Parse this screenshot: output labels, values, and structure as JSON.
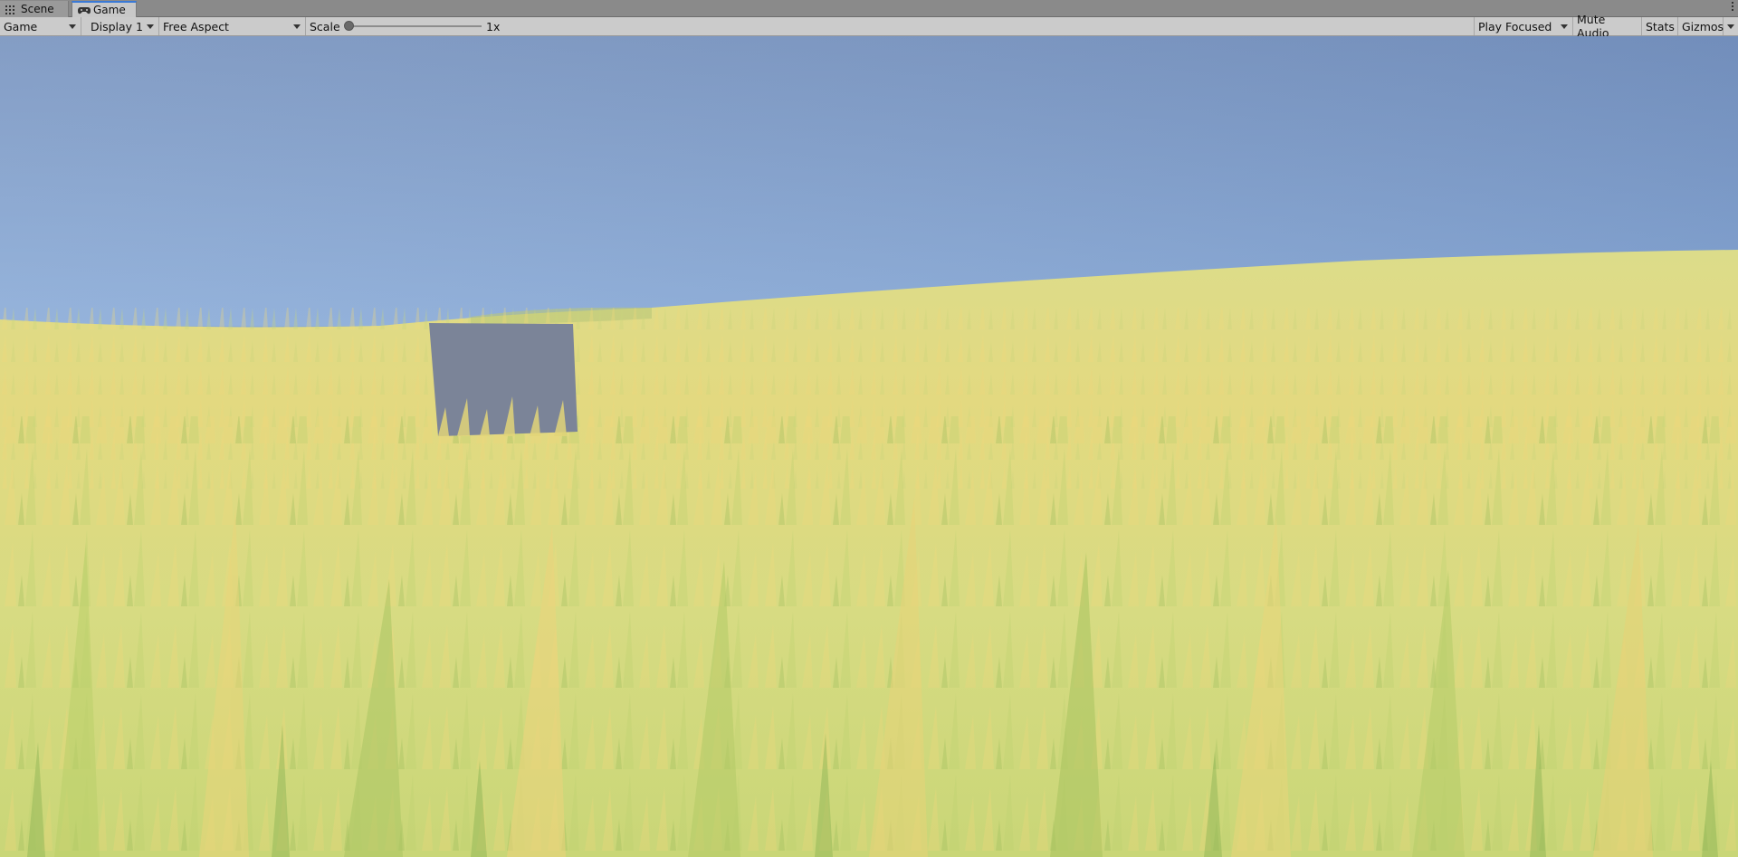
{
  "tabs": [
    {
      "label": "Scene",
      "icon": "grid-icon",
      "active": false
    },
    {
      "label": "Game",
      "icon": "gamepad-icon",
      "active": true
    }
  ],
  "toolbar": {
    "view_mode": "Game",
    "display": "Display 1",
    "aspect": "Free Aspect",
    "scale_label": "Scale",
    "scale_value": "1x",
    "scale_slider_fraction": 0.0,
    "play_mode": "Play Focused",
    "mute_audio": "Mute Audio",
    "stats": "Stats",
    "gizmos": "Gizmos"
  },
  "colors": {
    "accent": "#3a79d6",
    "sky_top": "#7591bd",
    "sky_horizon": "#eef6ff",
    "grass_far": "#d9d989",
    "grass_near": "#cbd67a",
    "cube": "#7b8498"
  }
}
